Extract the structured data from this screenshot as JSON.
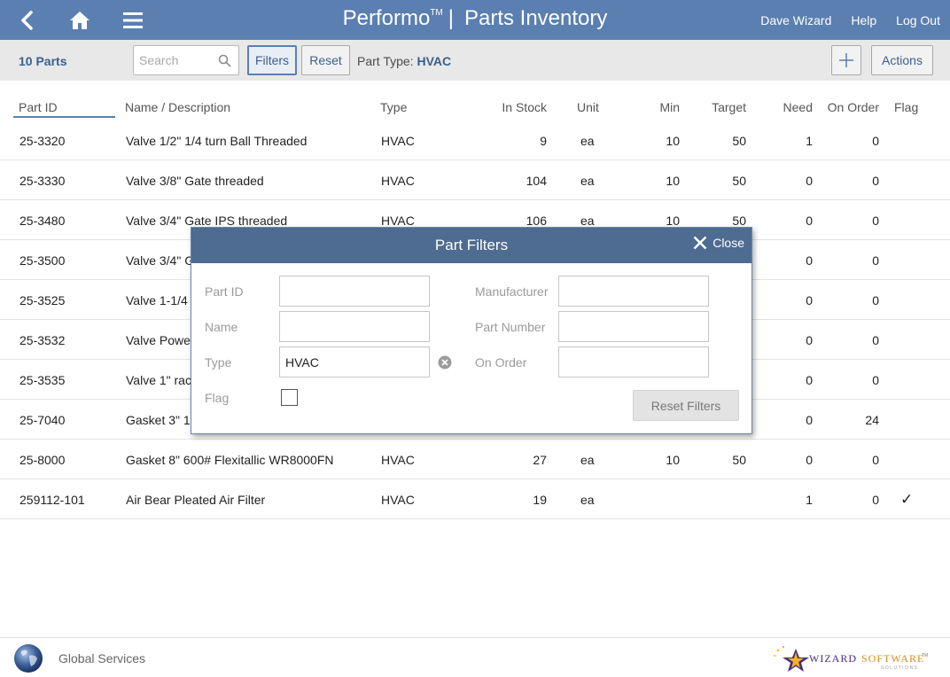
{
  "header": {
    "app_name": "Performo",
    "tm": "TM",
    "separator": "|",
    "page_title": "Parts Inventory",
    "user": "Dave Wizard",
    "help": "Help",
    "logout": "Log Out"
  },
  "toolbar": {
    "count": "10 Parts",
    "search_placeholder": "Search",
    "filters": "Filters",
    "reset": "Reset",
    "filter_label": "Part Type:",
    "filter_value": "HVAC",
    "actions": "Actions"
  },
  "columns": [
    "Part ID",
    "Name / Description",
    "Type",
    "In Stock",
    "Unit",
    "Min",
    "Target",
    "Need",
    "On Order",
    "Flag"
  ],
  "rows": [
    {
      "id": "25-3320",
      "name": "Valve 1/2\" 1/4 turn Ball Threaded",
      "type": "HVAC",
      "stock": "9",
      "unit": "ea",
      "min": "10",
      "target": "50",
      "need": "1",
      "on_order": "0",
      "flag": ""
    },
    {
      "id": "25-3330",
      "name": "Valve 3/8\" Gate threaded",
      "type": "HVAC",
      "stock": "104",
      "unit": "ea",
      "min": "10",
      "target": "50",
      "need": "0",
      "on_order": "0",
      "flag": ""
    },
    {
      "id": "25-3480",
      "name": "Valve 3/4\" Gate IPS threaded",
      "type": "HVAC",
      "stock": "106",
      "unit": "ea",
      "min": "10",
      "target": "50",
      "need": "0",
      "on_order": "0",
      "flag": ""
    },
    {
      "id": "25-3500",
      "name": "Valve 3/4\" G",
      "type": "",
      "stock": "",
      "unit": "",
      "min": "",
      "target": "",
      "need": "0",
      "on_order": "0",
      "flag": ""
    },
    {
      "id": "25-3525",
      "name": "Valve 1-1/4",
      "type": "",
      "stock": "",
      "unit": "",
      "min": "",
      "target": "",
      "need": "0",
      "on_order": "0",
      "flag": ""
    },
    {
      "id": "25-3532",
      "name": "Valve Powe",
      "type": "",
      "stock": "",
      "unit": "",
      "min": "",
      "target": "",
      "need": "0",
      "on_order": "0",
      "flag": ""
    },
    {
      "id": "25-3535",
      "name": "Valve 1\" rac",
      "type": "",
      "stock": "",
      "unit": "",
      "min": "",
      "target": "",
      "need": "0",
      "on_order": "0",
      "flag": ""
    },
    {
      "id": "25-7040",
      "name": "Gasket 3\" 1",
      "type": "",
      "stock": "",
      "unit": "",
      "min": "",
      "target": "",
      "need": "0",
      "on_order": "24",
      "flag": ""
    },
    {
      "id": "25-8000",
      "name": "Gasket 8\" 600# Flexitallic WR8000FN",
      "type": "HVAC",
      "stock": "27",
      "unit": "ea",
      "min": "10",
      "target": "50",
      "need": "0",
      "on_order": "0",
      "flag": ""
    },
    {
      "id": "259112-101",
      "name": "Air Bear Pleated Air Filter",
      "type": "HVAC",
      "stock": "19",
      "unit": "ea",
      "min": "",
      "target": "",
      "need": "1",
      "on_order": "0",
      "flag": "✓"
    }
  ],
  "modal": {
    "title": "Part Filters",
    "close": "Close",
    "labels": {
      "part_id": "Part ID",
      "name": "Name",
      "type": "Type",
      "flag": "Flag",
      "manufacturer": "Manufacturer",
      "part_number": "Part Number",
      "on_order": "On Order"
    },
    "values": {
      "part_id": "",
      "name": "",
      "type": "HVAC",
      "manufacturer": "",
      "part_number": "",
      "on_order": ""
    },
    "flag_checked": false,
    "reset_filters": "Reset Filters"
  },
  "footer": {
    "location": "Global Services",
    "logo_word1": "WIZARD",
    "logo_word2": "SOFTWARE",
    "logo_tm": "TM",
    "logo_sub": "SOLUTIONS"
  },
  "colors": {
    "header_bg": "#5b7fb0",
    "accent_text": "#3a5f8f",
    "modal_header": "#4e6b91"
  }
}
